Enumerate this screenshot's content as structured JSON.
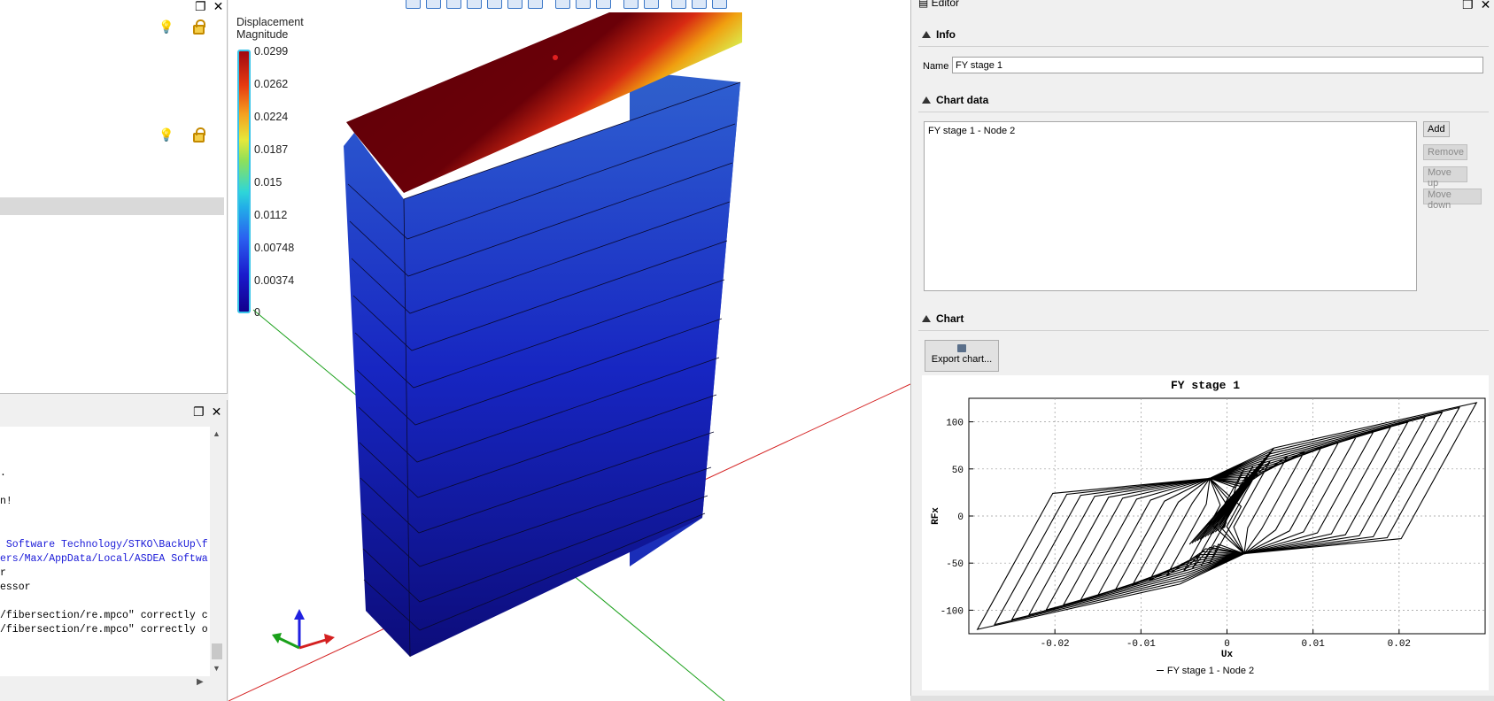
{
  "panels": {
    "close_glyph": "✕",
    "float_glyph": "❐"
  },
  "console": {
    "lines": [
      {
        "text": ".",
        "color": "black"
      },
      {
        "text": "n!",
        "color": "black"
      },
      {
        "text": " Software Technology/STKO\\BackUp\\f",
        "color": "blue"
      },
      {
        "text": "ers/Max/AppData/Local/ASDEA Softwa",
        "color": "blue"
      },
      {
        "text": "r",
        "color": "black"
      },
      {
        "text": "essor",
        "color": "black"
      },
      {
        "text": "/fibersection/re.mpco\" correctly c",
        "color": "black"
      },
      {
        "text": "/fibersection/re.mpco\" correctly o",
        "color": "black"
      }
    ]
  },
  "viewport": {
    "legend": {
      "title_line1": "Displacement",
      "title_line2": "Magnitude",
      "ticks": [
        "0.0299",
        "0.0262",
        "0.0224",
        "0.0187",
        "0.015",
        "0.0112",
        "0.00748",
        "0.00374",
        "0"
      ]
    },
    "colors": {
      "top_face": "#5a0008",
      "front_face": "#1e3ec8",
      "axis_x": "#d42020",
      "axis_y": "#1aa01a",
      "axis_z": "#2020e0"
    }
  },
  "editor": {
    "title": "Editor",
    "info": {
      "header": "Info",
      "name_label": "Name",
      "name_value": "FY stage 1"
    },
    "chart_data_section": {
      "header": "Chart data",
      "items": [
        "FY stage 1 - Node 2"
      ],
      "add_label": "Add",
      "remove_label": "Remove",
      "move_up_label": "Move up",
      "move_down_label": "Move down"
    },
    "chart_section": {
      "header": "Chart",
      "export_label": "Export chart..."
    }
  },
  "chart_data": {
    "type": "line",
    "title": "FY stage 1",
    "xlabel": "Ux",
    "ylabel": "RFx",
    "xlim": [
      -0.03,
      0.03
    ],
    "ylim": [
      -125,
      125
    ],
    "xticks": [
      -0.02,
      -0.01,
      0,
      0.01,
      0.02
    ],
    "xtick_labels": [
      "-0.02",
      "-0.01",
      "0",
      "0.01",
      "0.02"
    ],
    "yticks": [
      -100,
      -50,
      0,
      50,
      100
    ],
    "ytick_labels": [
      "-100",
      "-50",
      "0",
      "50",
      "100"
    ],
    "grid": true,
    "legend": "bottom-center",
    "series": [
      {
        "name": "FY stage 1 - Node 2",
        "description": "hysteresis cycles",
        "x": [
          0,
          0.002,
          0.003,
          0.004,
          -0.002,
          -0.003,
          -0.004,
          0.005,
          0.007,
          0.009,
          -0.006,
          -0.008,
          -0.01,
          0.011,
          0.013,
          0.015,
          -0.012,
          -0.014,
          -0.016,
          0.017,
          0.019,
          0.021,
          -0.018,
          -0.02,
          -0.022,
          0.023,
          0.025,
          0.027,
          -0.024,
          -0.026,
          -0.028,
          0.029
        ],
        "y": [
          0,
          40,
          55,
          70,
          -40,
          -55,
          -70,
          80,
          95,
          110,
          -80,
          -95,
          -108,
          115,
          118,
          120,
          -112,
          -115,
          -118,
          120,
          121,
          122,
          -118,
          -119,
          -120,
          122,
          121,
          120,
          -120,
          -119,
          -118,
          120
        ]
      }
    ]
  }
}
